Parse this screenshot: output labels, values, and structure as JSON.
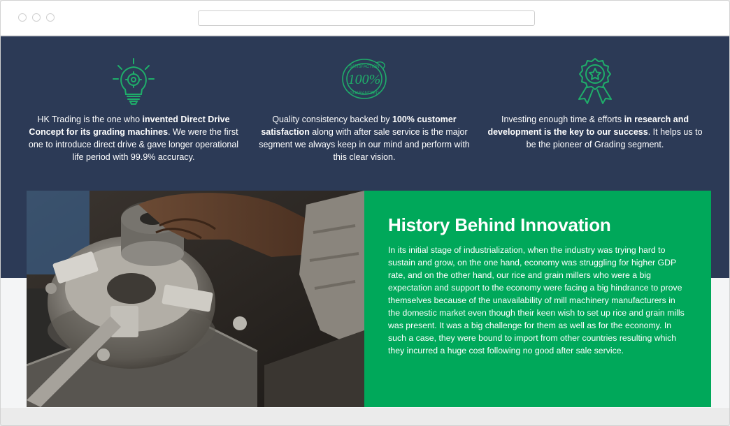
{
  "features": [
    {
      "icon": "lightbulb-gear-icon",
      "segments": [
        {
          "t": "HK Trading is the one who ",
          "b": false
        },
        {
          "t": "invented Direct Drive Concept for its grading machines",
          "b": true
        },
        {
          "t": ". We were the first one to introduce direct drive & gave longer operational life period with 99.9% accuracy.",
          "b": false
        }
      ]
    },
    {
      "icon": "satisfaction-guaranteed-stamp-icon",
      "stamp_top": "SATISFACTION",
      "stamp_center": "100%",
      "stamp_bottom": "GUARANTEED",
      "segments": [
        {
          "t": "Quality consistency backed by ",
          "b": false
        },
        {
          "t": "100% customer satisfaction",
          "b": true
        },
        {
          "t": " along with after sale service is the major segment we always keep in our mind and perform with this clear vision.",
          "b": false
        }
      ]
    },
    {
      "icon": "award-ribbon-icon",
      "segments": [
        {
          "t": "Investing enough time & efforts ",
          "b": false
        },
        {
          "t": "in research and development is the key to our success",
          "b": true
        },
        {
          "t": ". It helps us to be the pioneer of Grading segment.",
          "b": false
        }
      ]
    }
  ],
  "history": {
    "title": "History Behind Innovation",
    "body": "In its initial stage of industrialization, when the industry was trying hard to sustain and grow, on the one hand, economy was struggling for higher GDP rate, and on the other hand, our rice and grain millers who were a big expectation and support to the economy were facing a big hindrance to prove themselves because of the unavailability of mill machinery manufacturers in the domestic market even though their keen wish to set up rice and grain mills was present. It was a big challenge for them as well as for the economy. In such a case, they were bound to import from other countries resulting which they incurred a huge cost following no good after sale service."
  },
  "colors": {
    "navy": "#2c3a56",
    "green": "#00a85a",
    "icon_green": "#1fae6a"
  }
}
